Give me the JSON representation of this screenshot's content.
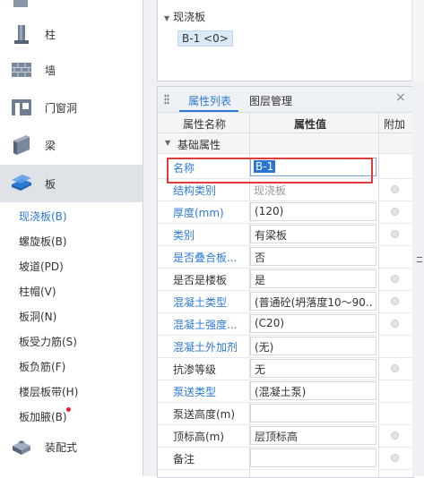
{
  "sidebar": {
    "categories": [
      {
        "label": "柱",
        "icon": "column-icon"
      },
      {
        "label": "墙",
        "icon": "wall-icon"
      },
      {
        "label": "门窗洞",
        "icon": "door-window-icon"
      },
      {
        "label": "梁",
        "icon": "beam-icon"
      },
      {
        "label": "板",
        "icon": "slab-icon"
      },
      {
        "label": "装配式",
        "icon": "prefab-icon"
      }
    ],
    "slab_items": [
      "现浇板(B)",
      "螺旋板(B)",
      "坡道(PD)",
      "柱帽(V)",
      "板洞(N)",
      "板受力筋(S)",
      "板负筋(F)",
      "楼层板带(H)",
      "板加腋(B)"
    ]
  },
  "tree": {
    "node": "现浇板",
    "chip": "B-1 <0>"
  },
  "panel": {
    "tabs": [
      "属性列表",
      "图层管理"
    ],
    "close": "×",
    "columns": {
      "name": "属性名称",
      "value": "属性值",
      "add": "附加"
    },
    "group": "基础属性",
    "rows": [
      {
        "name": "名称",
        "value": "B-1"
      },
      {
        "name": "结构类别",
        "value": "现浇板"
      },
      {
        "name": "厚度(mm)",
        "value": "(120)"
      },
      {
        "name": "类别",
        "value": "有梁板"
      },
      {
        "name": "是否叠合板...",
        "value": "否"
      },
      {
        "name": "是否是楼板",
        "value": "是"
      },
      {
        "name": "混凝土类型",
        "value": "(普通砼(坍落度10～90..."
      },
      {
        "name": "混凝土强度...",
        "value": "(C20)"
      },
      {
        "name": "混凝土外加剂",
        "value": "(无)"
      },
      {
        "name": "抗渗等级",
        "value": "无"
      },
      {
        "name": "泵送类型",
        "value": "(混凝土泵)"
      },
      {
        "name": "泵送高度(m)",
        "value": ""
      },
      {
        "name": "顶标高(m)",
        "value": "层顶标高"
      },
      {
        "name": "备注",
        "value": ""
      }
    ]
  },
  "colors": {
    "accent": "#2d7ad6",
    "highlight_box": "#e23b3b",
    "selected_category": "#dfe3e8"
  }
}
